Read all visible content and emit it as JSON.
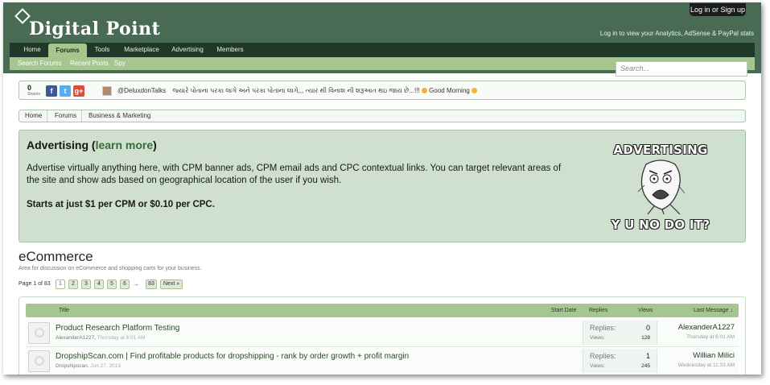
{
  "header": {
    "site_name": "Digital Point",
    "login_button": "Log in or Sign up",
    "login_hint": "Log in to view your Analytics, AdSense & PayPal stats",
    "search_placeholder": "Search..."
  },
  "nav": {
    "tabs": [
      {
        "label": "Home",
        "active": false
      },
      {
        "label": "Forums",
        "active": true
      },
      {
        "label": "Tools",
        "active": false
      },
      {
        "label": "Marketplace",
        "active": false
      },
      {
        "label": "Advertising",
        "active": false
      },
      {
        "label": "Members",
        "active": false
      }
    ],
    "sub": [
      "Search Forums",
      "Recent Posts",
      "Spy"
    ]
  },
  "sharebar": {
    "count": "0",
    "count_label": "Shares",
    "buttons": [
      {
        "icon": "facebook-icon",
        "glyph": "f",
        "color": "#3b5998"
      },
      {
        "icon": "twitter-icon",
        "glyph": "t",
        "color": "#55acee"
      },
      {
        "icon": "google-plus-icon",
        "glyph": "g+",
        "color": "#dd4b39"
      }
    ],
    "tweet_user": "@DeluxdonTalks",
    "tweet_text": "જ્યારે પોતાના પરકા લાગે અને પરકા પોતાના લાગે,,, ત્યાર થી વિનાશ ની શરૂઆત થઇ જાય છે...!!!",
    "tweet_tail": "Good Morning"
  },
  "breadcrumb": [
    "Home",
    "Forums",
    "Business & Marketing"
  ],
  "ad": {
    "title": "Advertising",
    "learn_more": "learn more",
    "body": "Advertise virtually anything here, with CPM banner ads, CPM email ads and CPC contextual links. You can target relevant areas of the site and show ads based on geographical location of the user if you wish.",
    "price": "Starts at just $1 per CPM or $0.10 per CPC.",
    "meme_top": "ADVERTISING",
    "meme_bottom": "Y U NO DO IT?"
  },
  "forum": {
    "title": "eCommerce",
    "description": "Area for discussion on eCommerce and shopping carts for your business.",
    "page_of": "Page 1 of 83",
    "pages": [
      "1",
      "2",
      "3",
      "4",
      "5",
      "6"
    ],
    "last_page": "83",
    "next_label": "Next »"
  },
  "table": {
    "headers": {
      "title": "Title",
      "start_date": "Start Date",
      "replies": "Replies",
      "views": "Views",
      "last_message": "Last Message ↓"
    },
    "rows": [
      {
        "title": "Product Research Platform Testing",
        "author": "AlexanderA1227",
        "date": "Thursday at 6:01 AM",
        "replies_label": "Replies:",
        "replies": "0",
        "views_label": "Views:",
        "views": "128",
        "last_user": "AlexanderA1227",
        "last_date": "Thursday at 6:01 AM"
      },
      {
        "title": "DropshipScan.com | Find profitable products for dropshipping - rank by order growth + profit margin",
        "author": "Dropshipscan",
        "date": "Jun 27, 2019",
        "replies_label": "Replies:",
        "replies": "1",
        "views_label": "Views:",
        "views": "245",
        "last_user": "Willian Milici",
        "last_date": "Wednesday at 11:33 AM"
      }
    ]
  }
}
